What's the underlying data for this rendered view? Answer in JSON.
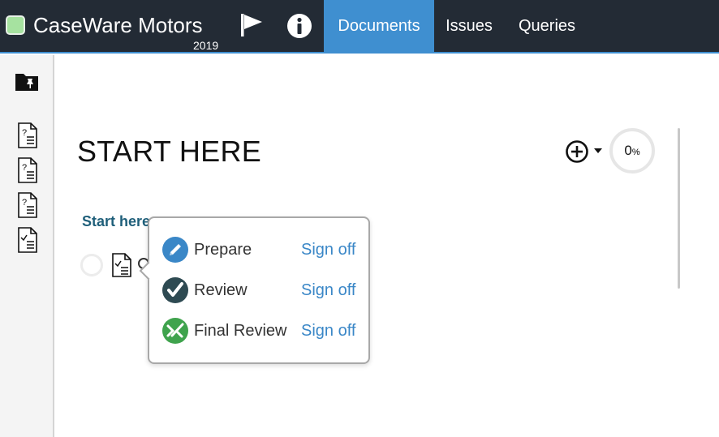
{
  "header": {
    "app_title": "CaseWare Motors",
    "year": "2019",
    "brand_color": "#a6e2a0",
    "tabs": [
      {
        "label": "Documents",
        "active": true
      },
      {
        "label": "Issues",
        "active": false
      },
      {
        "label": "Queries",
        "active": false
      }
    ],
    "icons": [
      "flag-icon",
      "info-icon"
    ]
  },
  "sidebar": {
    "items": [
      {
        "icon": "pinned-folder-icon"
      },
      {
        "icon": "document-query-icon"
      },
      {
        "icon": "document-query-icon"
      },
      {
        "icon": "document-query-icon"
      },
      {
        "icon": "document-checklist-icon"
      }
    ]
  },
  "main": {
    "title": "START HERE",
    "progress": {
      "value": "0",
      "unit": "%"
    },
    "section_link": "Start here",
    "add_icon": "add-circle-icon",
    "caret_icon": "caret-down-icon"
  },
  "signoff_popup": {
    "rows": [
      {
        "label": "Prepare",
        "action": "Sign off",
        "icon": "pencil-icon",
        "color": "#3a87c7"
      },
      {
        "label": "Review",
        "action": "Sign off",
        "icon": "checkmark-icon",
        "color": "#2e4a52"
      },
      {
        "label": "Final Review",
        "action": "Sign off",
        "icon": "final-review-icon",
        "color": "#3fa34d"
      }
    ]
  }
}
